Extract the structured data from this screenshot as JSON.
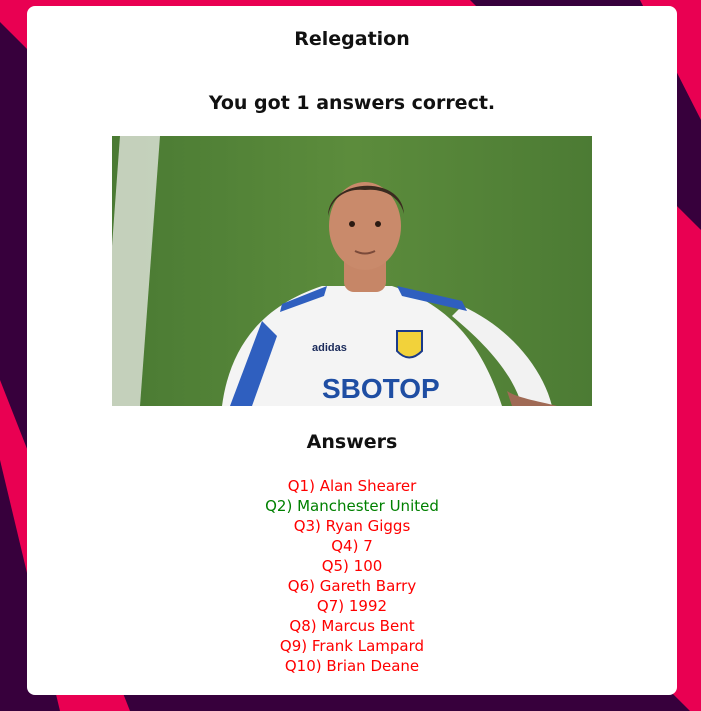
{
  "quiz": {
    "title": "Relegation",
    "result_text": "You got 1 answers correct."
  },
  "image": {
    "description_icon": "player-photo",
    "jersey_text": "SBOTOP",
    "brand_text": "adidas"
  },
  "answers": {
    "heading": "Answers",
    "items": [
      {
        "label": "Q1) Alan Shearer",
        "correct": false
      },
      {
        "label": "Q2) Manchester United",
        "correct": true
      },
      {
        "label": "Q3) Ryan Giggs",
        "correct": false
      },
      {
        "label": "Q4) 7",
        "correct": false
      },
      {
        "label": "Q5) 100",
        "correct": false
      },
      {
        "label": "Q6) Gareth Barry",
        "correct": false
      },
      {
        "label": "Q7) 1992",
        "correct": false
      },
      {
        "label": "Q8) Marcus Bent",
        "correct": false
      },
      {
        "label": "Q9) Frank Lampard",
        "correct": false
      },
      {
        "label": "Q10) Brian Deane",
        "correct": false
      }
    ]
  },
  "colors": {
    "background": "#37003c",
    "accent": "#e90052",
    "correct": "#008000",
    "incorrect": "#ff0000"
  }
}
